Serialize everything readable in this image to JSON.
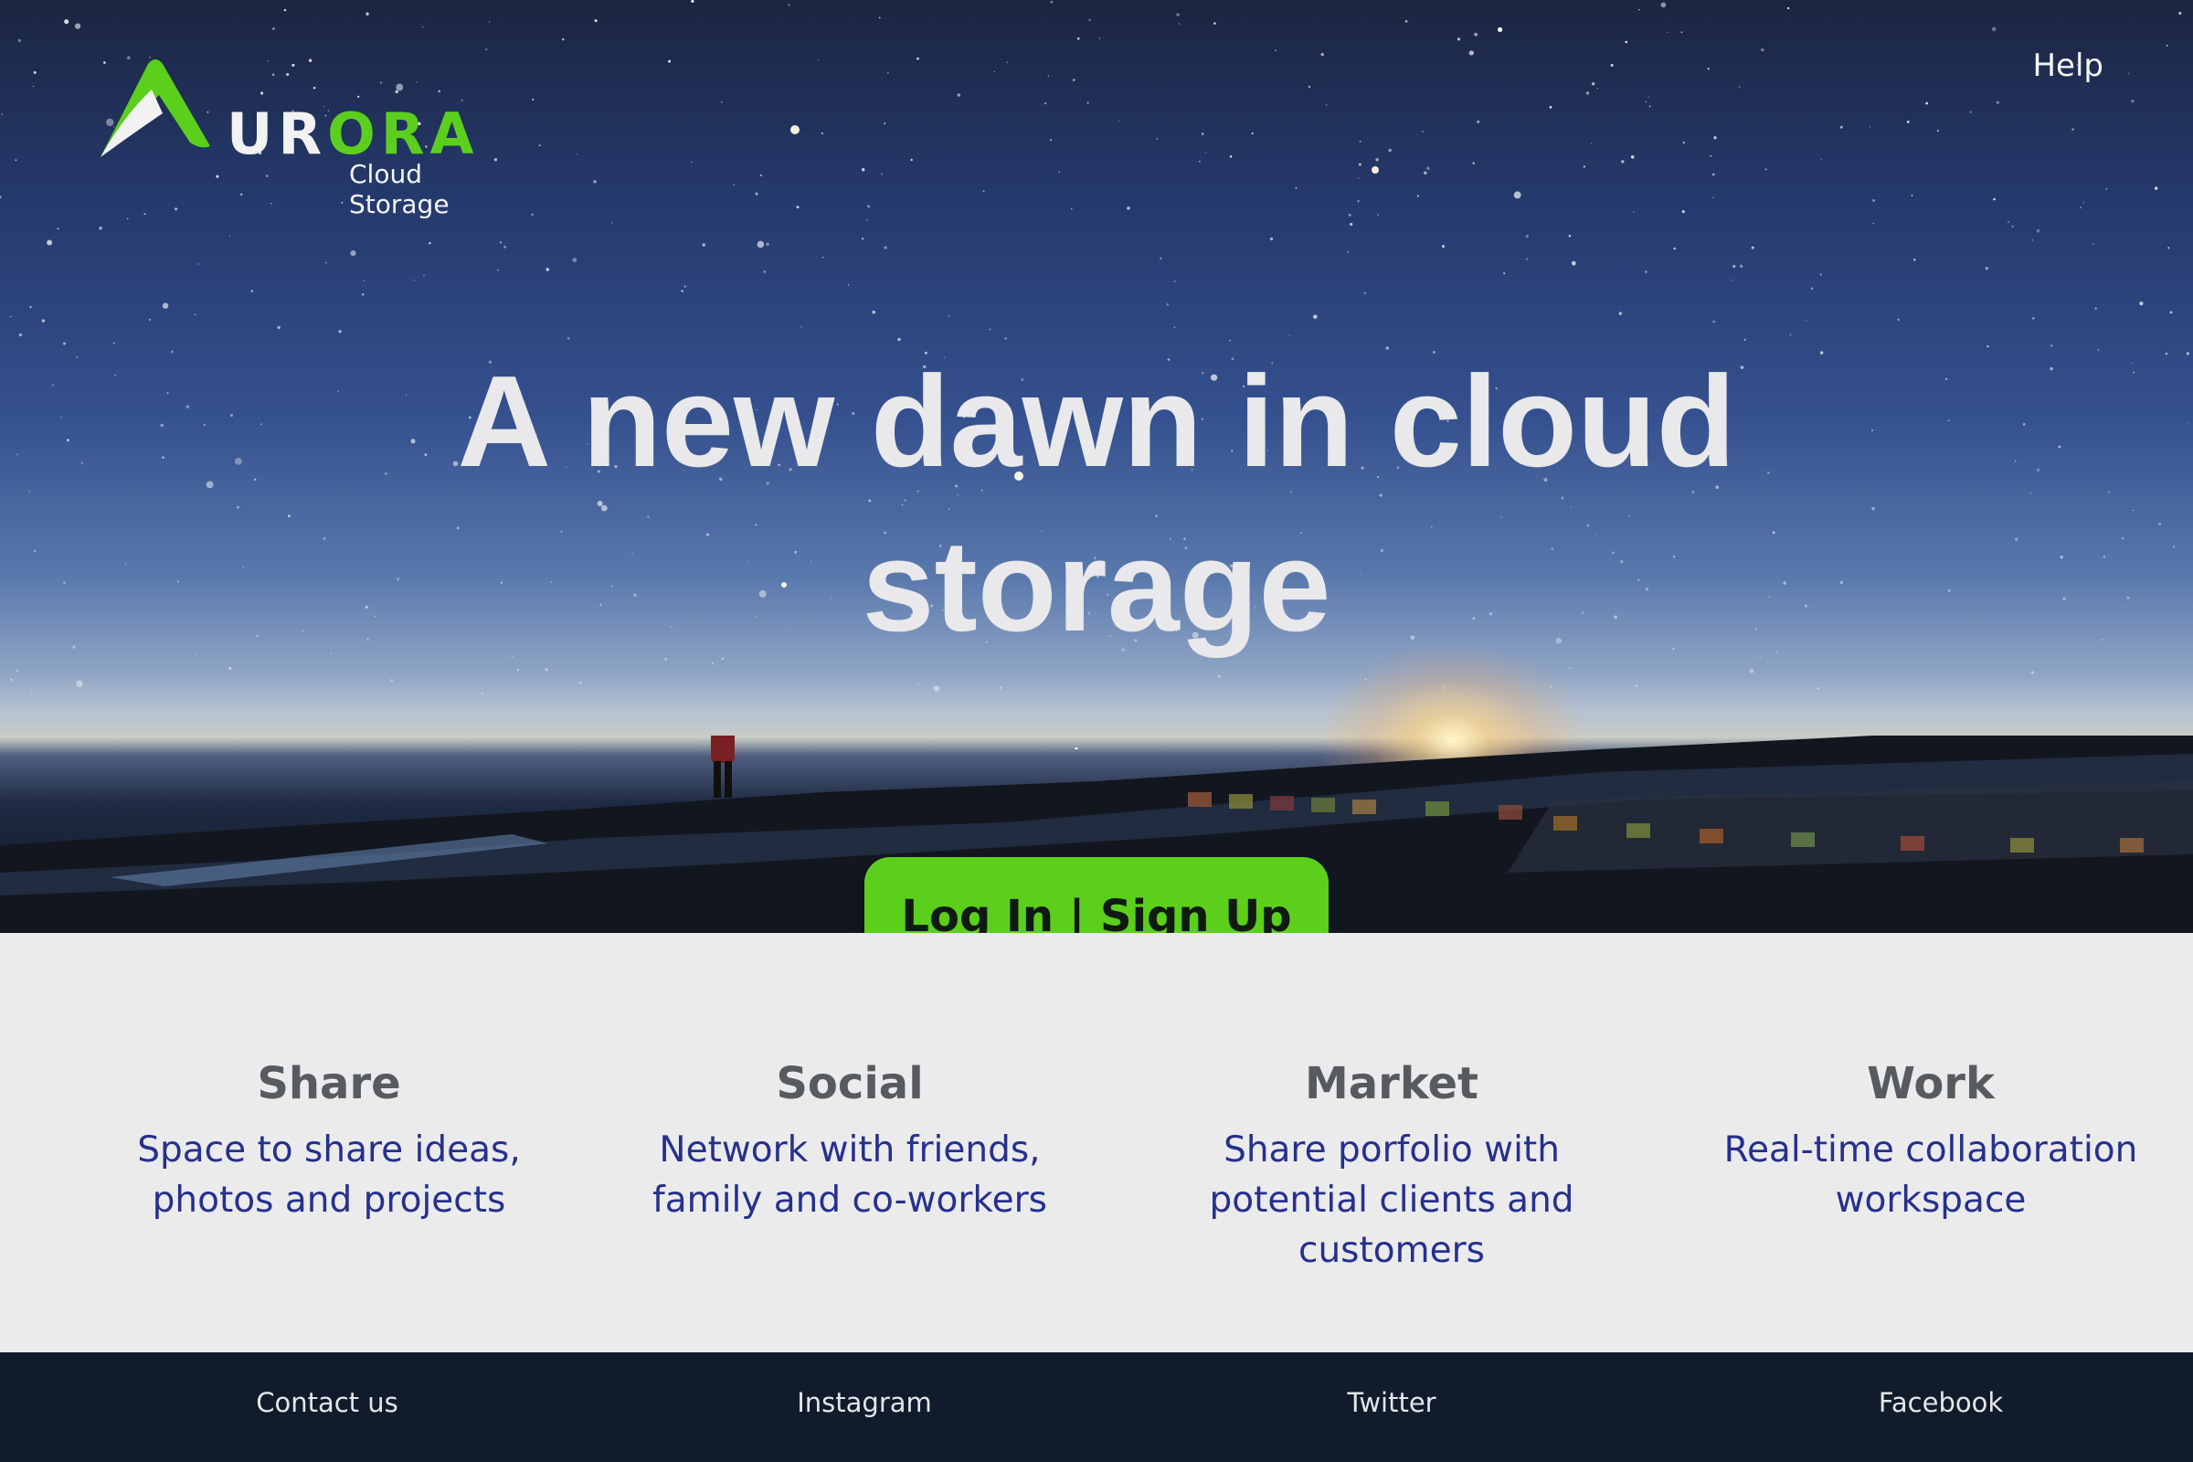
{
  "header": {
    "logo": {
      "wordmark_white": "UR",
      "wordmark_green": "ORA",
      "subtitle": "Cloud Storage",
      "brand_green": "#5bcf1c"
    },
    "help_label": "Help"
  },
  "hero": {
    "headline": "A new dawn in cloud storage",
    "cta_label": "Log In | Sign Up"
  },
  "features": [
    {
      "title": "Share",
      "description": "Space to share ideas, photos and projects"
    },
    {
      "title": "Social",
      "description": "Network with friends, family and co-workers"
    },
    {
      "title": "Market",
      "description": "Share porfolio with potential clients and customers"
    },
    {
      "title": "Work",
      "description": "Real-time collaboration workspace"
    }
  ],
  "footer": {
    "links": [
      "Contact us",
      "Instagram",
      "Twitter",
      "Facebook"
    ]
  },
  "colors": {
    "accent_green": "#5bcf1c",
    "feature_title": "#575b60",
    "feature_text": "#26308d",
    "footer_bg": "#101b2b",
    "section_bg": "#ebebec"
  }
}
